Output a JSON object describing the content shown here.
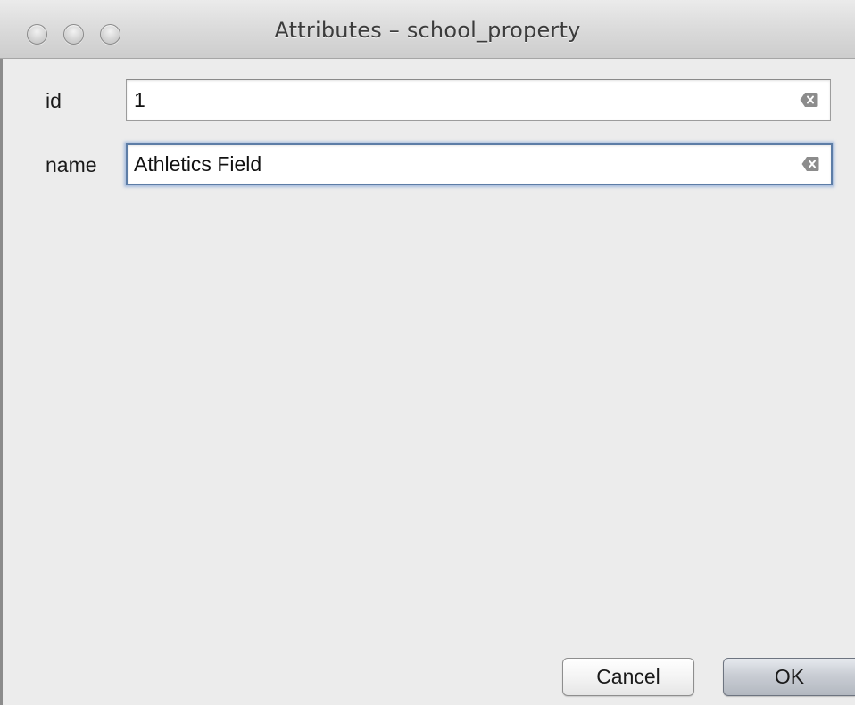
{
  "window": {
    "title": "Attributes – school_property"
  },
  "fields": [
    {
      "label": "id",
      "value": "1"
    },
    {
      "label": "name",
      "value": "Athletics Field"
    }
  ],
  "buttons": {
    "cancel_label": "Cancel",
    "ok_label": "OK"
  },
  "icons": {
    "window_controls": [
      "close-icon",
      "minimize-icon",
      "zoom-icon"
    ],
    "field_clear": "clear-text-icon"
  },
  "colors": {
    "focus_ring": "#5d7da6",
    "window_background": "#ececec"
  }
}
